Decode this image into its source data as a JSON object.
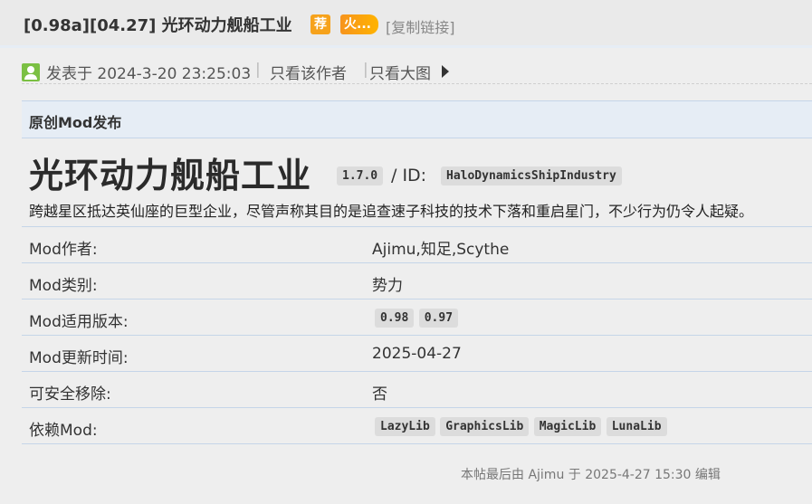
{
  "thread": {
    "title": "[0.98a][04.27] 光环动力舰船工业",
    "badge_recommend": "荐",
    "badge_hot": "火...",
    "copy_link": "[复制链接]"
  },
  "post": {
    "time": "发表于 2024-3-20 23:25:03",
    "separator": "|",
    "only_author": "只看该作者",
    "big_image": "只看大图"
  },
  "section": {
    "title": "原创Mod发布"
  },
  "mod": {
    "name": "光环动力舰船工业",
    "version": "1.7.0",
    "id_label": "/ ID:",
    "id": "HaloDynamicsShipIndustry",
    "description": "跨越星区抵达英仙座的巨型企业，尽管声称其目的是追查速子科技的技术下落和重启星门，不少行为仍令人起疑。"
  },
  "info": {
    "author_label": "Mod作者:",
    "author_value": "Ajimu,知足,Scythe",
    "category_label": "Mod类别:",
    "category_value": "势力",
    "versions_label": "Mod适用版本:",
    "versions": [
      "0.98",
      "0.97"
    ],
    "updated_label": "Mod更新时间:",
    "updated_value": "2025-04-27",
    "removable_label": "可安全移除:",
    "removable_value": "否",
    "deps_label": "依赖Mod:",
    "deps": [
      "LazyLib",
      "GraphicsLib",
      "MagicLib",
      "LunaLib"
    ]
  },
  "footer": {
    "edit_note": "本帖最后由 Ajimu 于 2025-4-27 15:30 编辑"
  },
  "colors": {
    "accent_orange": "#f6a21b",
    "section_bg": "#e6edf5",
    "row_border": "#c5d5e8",
    "tag_bg": "#dcdcdc"
  },
  "icons": [
    "user-icon",
    "play-icon"
  ]
}
